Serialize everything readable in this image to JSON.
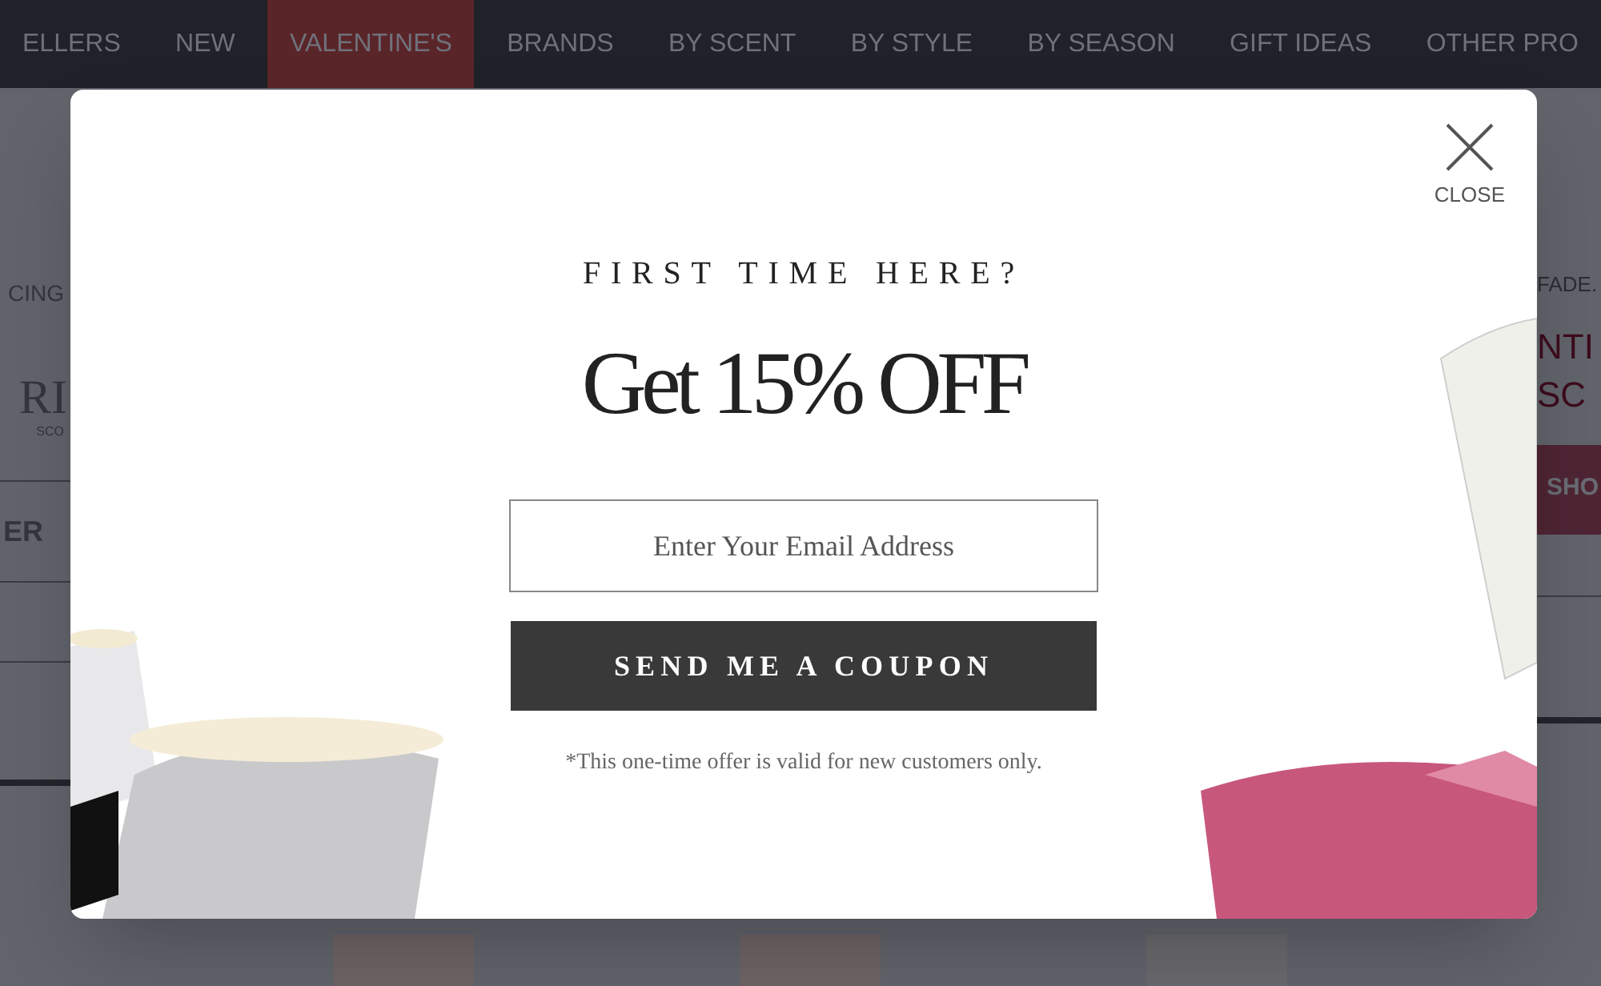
{
  "nav": {
    "items": [
      {
        "label": "ELLERS",
        "selected": false
      },
      {
        "label": "NEW",
        "selected": false
      },
      {
        "label": "VALENTINE'S",
        "selected": true
      },
      {
        "label": "BRANDS",
        "selected": false
      },
      {
        "label": "BY SCENT",
        "selected": false
      },
      {
        "label": "BY STYLE",
        "selected": false
      },
      {
        "label": "BY SEASON",
        "selected": false
      },
      {
        "label": "GIFT IDEAS",
        "selected": false
      },
      {
        "label": "OTHER PRO",
        "selected": false
      }
    ]
  },
  "left_panel": {
    "heading": "CING",
    "logo": "RI",
    "logo_sub": "SCO",
    "button": "ER"
  },
  "right_panel": {
    "heading": "FADE.",
    "title_line_1": "NTI",
    "title_line_2": "SC",
    "button": "SHO"
  },
  "modal": {
    "close_label": "CLOSE",
    "heading": "FIRST TIME HERE?",
    "offer": "Get 15% OFF",
    "email_field": {
      "placeholder": "Enter Your Email Address"
    },
    "submit_button": "SEND ME A COUPON",
    "disclaimer": "*This one-time offer is valid for new customers only."
  }
}
